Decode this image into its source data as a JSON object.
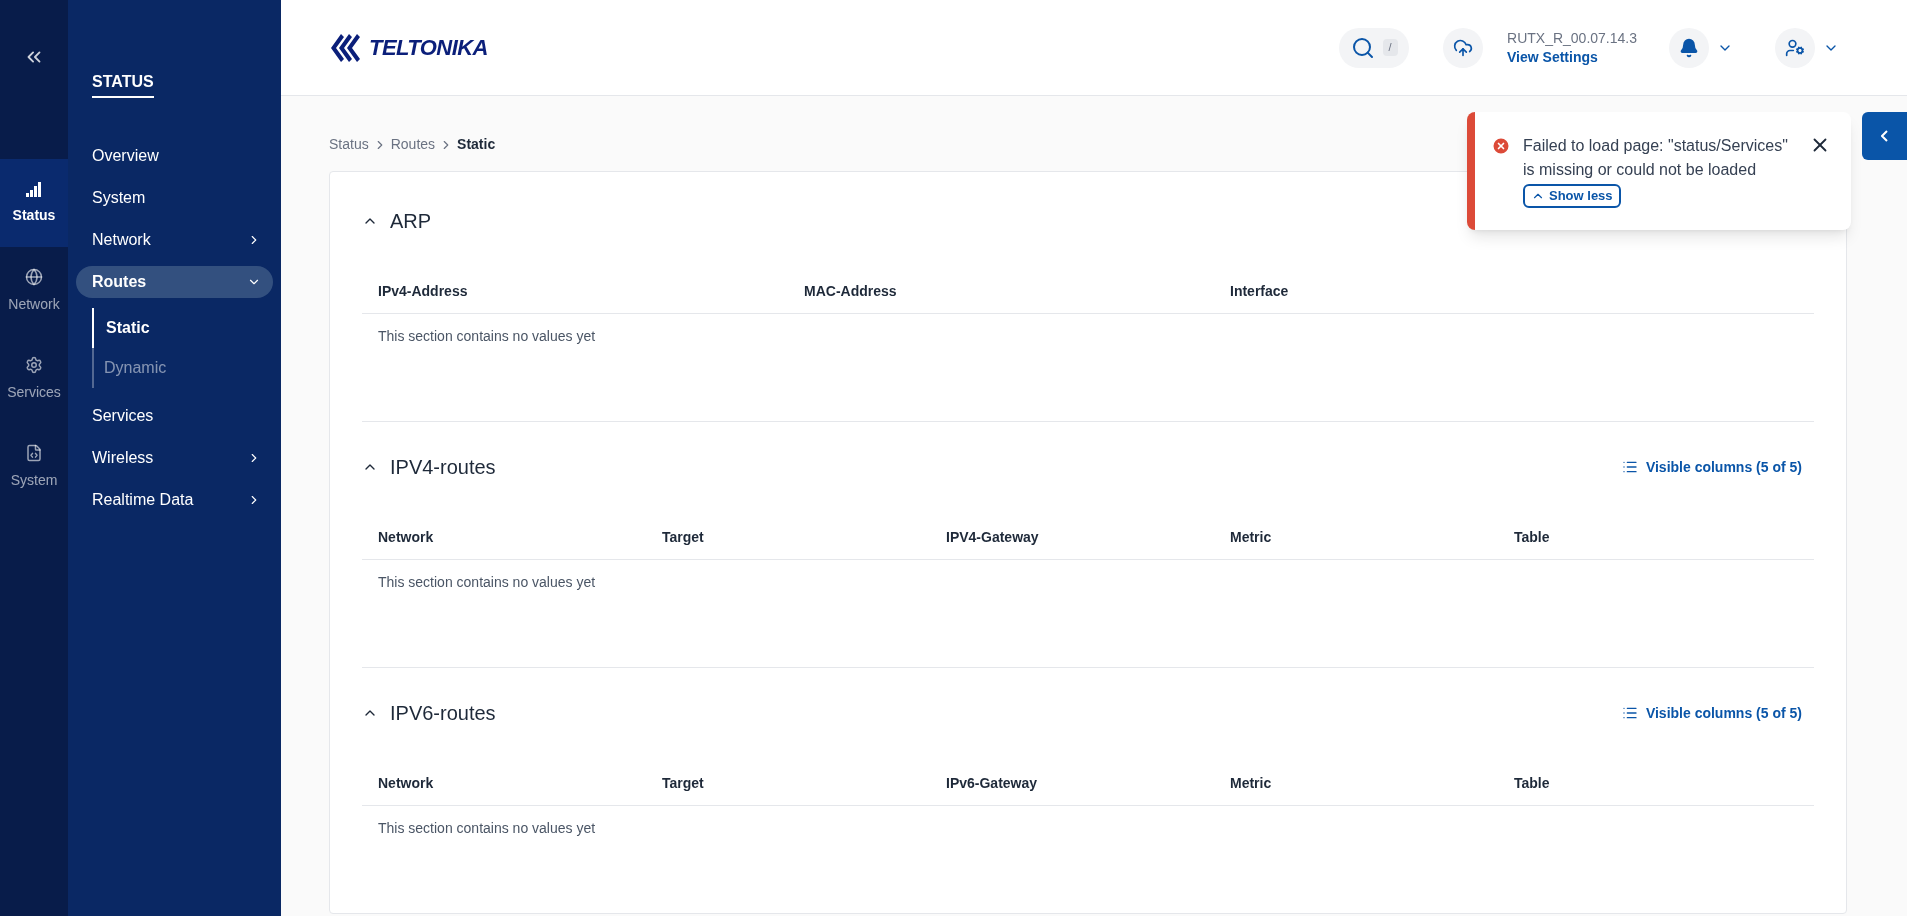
{
  "rail": {
    "items": [
      {
        "label": "Status",
        "selected": true
      },
      {
        "label": "Network",
        "selected": false
      },
      {
        "label": "Services",
        "selected": false
      },
      {
        "label": "System",
        "selected": false
      }
    ]
  },
  "nav": {
    "title": "STATUS",
    "items": [
      {
        "label": "Overview",
        "has_submenu": false,
        "selected": false
      },
      {
        "label": "System",
        "has_submenu": false,
        "selected": false
      },
      {
        "label": "Network",
        "has_submenu": true,
        "expanded": false,
        "selected": false
      },
      {
        "label": "Routes",
        "has_submenu": true,
        "expanded": true,
        "selected": true,
        "children": [
          {
            "label": "Static",
            "selected": true
          },
          {
            "label": "Dynamic",
            "selected": false
          }
        ]
      },
      {
        "label": "Services",
        "has_submenu": false,
        "selected": false
      },
      {
        "label": "Wireless",
        "has_submenu": true,
        "expanded": false,
        "selected": false
      },
      {
        "label": "Realtime Data",
        "has_submenu": true,
        "expanded": false,
        "selected": false
      }
    ]
  },
  "header": {
    "logo": "TELTONIKA",
    "search_shortcut": "/",
    "firmware": "RUTX_R_00.07.14.3",
    "settings_link": "View Settings"
  },
  "breadcrumb": [
    "Status",
    "Routes",
    "Static"
  ],
  "sections": [
    {
      "title": "ARP",
      "expanded": true,
      "columns": [
        "IPv4-Address",
        "MAC-Address",
        "Interface"
      ],
      "empty": "This section contains no values yet"
    },
    {
      "title": "IPV4-routes",
      "expanded": true,
      "visible_columns": "Visible columns (5 of 5)",
      "columns": [
        "Network",
        "Target",
        "IPV4-Gateway",
        "Metric",
        "Table"
      ],
      "empty": "This section contains no values yet"
    },
    {
      "title": "IPV6-routes",
      "expanded": true,
      "visible_columns": "Visible columns (5 of 5)",
      "columns": [
        "Network",
        "Target",
        "IPv6-Gateway",
        "Metric",
        "Table"
      ],
      "empty": "This section contains no values yet"
    }
  ],
  "notification": {
    "message": "Failed to load page: \"status/Services\" is missing or could not be loaded",
    "toggle": "Show less"
  }
}
